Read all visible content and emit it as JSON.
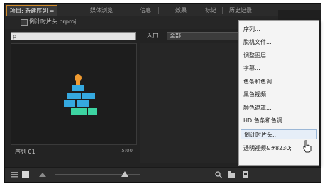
{
  "tabs": [
    {
      "label": "项目: 新建序列 ="
    },
    {
      "label": "媒体浏览"
    },
    {
      "label": "信息"
    },
    {
      "label": "效果"
    },
    {
      "label": "标记"
    },
    {
      "label": "历史记录"
    }
  ],
  "project": {
    "file_name": "倒计时片头.prproj"
  },
  "search": {
    "placeholder": "ρ"
  },
  "inpoint": {
    "label": "入口:",
    "value": "全部"
  },
  "item": {
    "name": "序列 01",
    "duration": "5:00"
  },
  "menu": {
    "items": [
      {
        "label": "序列..."
      },
      {
        "label": "脱机文件..."
      },
      {
        "label": "调整图层..."
      },
      {
        "label": "字幕..."
      },
      {
        "label": "色条和色调..."
      },
      {
        "label": "黑色视频..."
      },
      {
        "label": "颜色遮罩..."
      },
      {
        "label": "HD 色条和色调..."
      },
      {
        "label": "倒计时片头..."
      },
      {
        "label": "透明视频&#8230;"
      }
    ],
    "highlighted_index": 8
  },
  "colors": {
    "active_tab_border": "#d08a2a",
    "thumb_orange": "#f09a30",
    "thumb_blue": "#35a9e0",
    "thumb_green": "#3dd4a2"
  }
}
